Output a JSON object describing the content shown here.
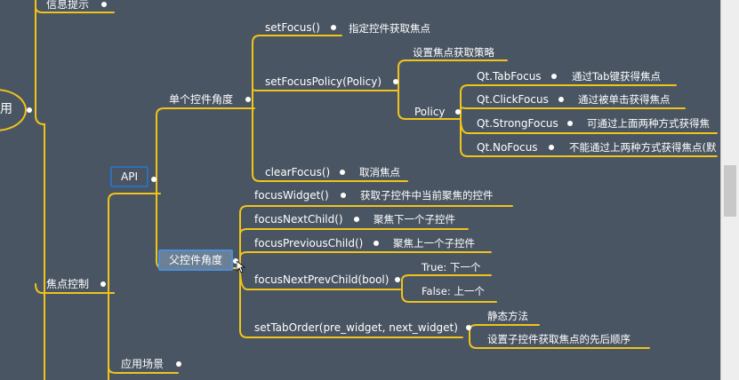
{
  "root": {
    "label": "用"
  },
  "top": {
    "info_tip": "信息提示"
  },
  "branches": {
    "focus_control": "焦点控制",
    "api": "API",
    "app_scenario": "应用场景"
  },
  "single_widget": {
    "label": "单个控件角度",
    "set_focus": {
      "name": "setFocus()",
      "desc": "指定控件获取焦点"
    },
    "set_focus_policy": {
      "name": "setFocusPolicy(Policy)",
      "desc": "设置焦点获取策略",
      "policy_label": "Policy",
      "policies": [
        {
          "name": "Qt.TabFocus",
          "desc": "通过Tab键获得焦点"
        },
        {
          "name": "Qt.ClickFocus",
          "desc": "通过被单击获得焦点"
        },
        {
          "name": "Qt.StrongFocus",
          "desc": "可通过上面两种方式获得焦"
        },
        {
          "name": "Qt.NoFocus",
          "desc": "不能通过上两种方式获得焦点(默"
        }
      ]
    },
    "clear_focus": {
      "name": "clearFocus()",
      "desc": "取消焦点"
    }
  },
  "parent_widget": {
    "label": "父控件角度",
    "focus_widget": {
      "name": "focusWidget()",
      "desc": "获取子控件中当前聚焦的控件"
    },
    "focus_next": {
      "name": "focusNextChild()",
      "desc": "聚焦下一个子控件"
    },
    "focus_prev": {
      "name": "focusPreviousChild()",
      "desc": "聚焦上一个子控件"
    },
    "focus_next_prev": {
      "name": "focusNextPrevChild(bool)",
      "true_desc": "True: 下一个",
      "false_desc": "False: 上一个"
    },
    "set_tab_order": {
      "name": "setTabOrder(pre_widget, next_widget)",
      "static": "静态方法",
      "desc": "设置子控件获取焦点的先后顺序"
    }
  },
  "colors": {
    "background": "#4a5563",
    "line": "#f0c419",
    "box": "#2d6fb8",
    "text": "#ffffff"
  }
}
